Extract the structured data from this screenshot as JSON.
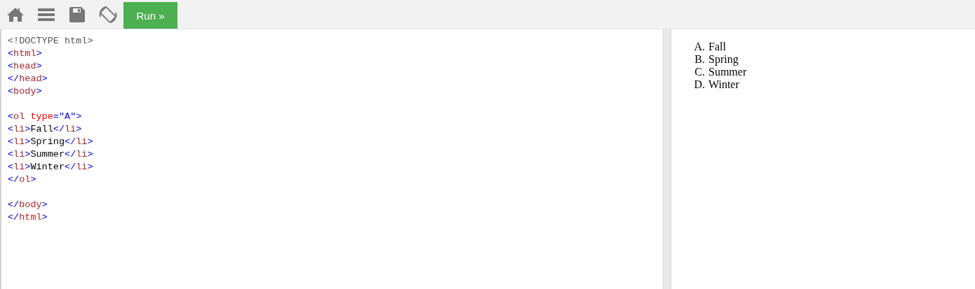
{
  "toolbar": {
    "run_button": "Run »"
  },
  "code_blocks": [
    [
      [
        {
          "kind": "doctype",
          "text": "<!DOCTYPE html>"
        }
      ],
      [
        {
          "kind": "bracket",
          "text": "<"
        },
        {
          "kind": "tag",
          "text": "html"
        },
        {
          "kind": "bracket",
          "text": ">"
        }
      ],
      [
        {
          "kind": "bracket",
          "text": "<"
        },
        {
          "kind": "tag",
          "text": "head"
        },
        {
          "kind": "bracket",
          "text": ">"
        }
      ],
      [
        {
          "kind": "bracket",
          "text": "</"
        },
        {
          "kind": "tag",
          "text": "head"
        },
        {
          "kind": "bracket",
          "text": ">"
        }
      ],
      [
        {
          "kind": "bracket",
          "text": "<"
        },
        {
          "kind": "tag",
          "text": "body"
        },
        {
          "kind": "bracket",
          "text": ">"
        }
      ]
    ],
    [
      [
        {
          "kind": "bracket",
          "text": "<"
        },
        {
          "kind": "tag",
          "text": "ol"
        },
        {
          "kind": "attr",
          "text": " type"
        },
        {
          "kind": "bracket",
          "text": "="
        },
        {
          "kind": "value",
          "text": "\"A\""
        },
        {
          "kind": "bracket",
          "text": ">"
        }
      ],
      [
        {
          "kind": "bracket",
          "text": "<"
        },
        {
          "kind": "tag",
          "text": "li"
        },
        {
          "kind": "bracket",
          "text": ">"
        },
        {
          "kind": "text",
          "text": "Fall"
        },
        {
          "kind": "bracket",
          "text": "</"
        },
        {
          "kind": "tag",
          "text": "li"
        },
        {
          "kind": "bracket",
          "text": ">"
        }
      ],
      [
        {
          "kind": "bracket",
          "text": "<"
        },
        {
          "kind": "tag",
          "text": "li"
        },
        {
          "kind": "bracket",
          "text": ">"
        },
        {
          "kind": "text",
          "text": "Spring"
        },
        {
          "kind": "bracket",
          "text": "</"
        },
        {
          "kind": "tag",
          "text": "li"
        },
        {
          "kind": "bracket",
          "text": ">"
        }
      ],
      [
        {
          "kind": "bracket",
          "text": "<"
        },
        {
          "kind": "tag",
          "text": "li"
        },
        {
          "kind": "bracket",
          "text": ">"
        },
        {
          "kind": "text",
          "text": "Summer"
        },
        {
          "kind": "bracket",
          "text": "</"
        },
        {
          "kind": "tag",
          "text": "li"
        },
        {
          "kind": "bracket",
          "text": ">"
        }
      ],
      [
        {
          "kind": "bracket",
          "text": "<"
        },
        {
          "kind": "tag",
          "text": "li"
        },
        {
          "kind": "bracket",
          "text": ">"
        },
        {
          "kind": "text",
          "text": "Winter"
        },
        {
          "kind": "bracket",
          "text": "</"
        },
        {
          "kind": "tag",
          "text": "li"
        },
        {
          "kind": "bracket",
          "text": ">"
        }
      ],
      [
        {
          "kind": "bracket",
          "text": "</"
        },
        {
          "kind": "tag",
          "text": "ol"
        },
        {
          "kind": "bracket",
          "text": ">"
        }
      ]
    ],
    [
      [
        {
          "kind": "bracket",
          "text": "</"
        },
        {
          "kind": "tag",
          "text": "body"
        },
        {
          "kind": "bracket",
          "text": ">"
        }
      ],
      [
        {
          "kind": "bracket",
          "text": "</"
        },
        {
          "kind": "tag",
          "text": "html"
        },
        {
          "kind": "bracket",
          "text": ">"
        }
      ]
    ]
  ],
  "output_list": [
    {
      "marker": "A.",
      "text": "Fall"
    },
    {
      "marker": "B.",
      "text": "Spring"
    },
    {
      "marker": "C.",
      "text": "Summer"
    },
    {
      "marker": "D.",
      "text": "Winter"
    }
  ]
}
